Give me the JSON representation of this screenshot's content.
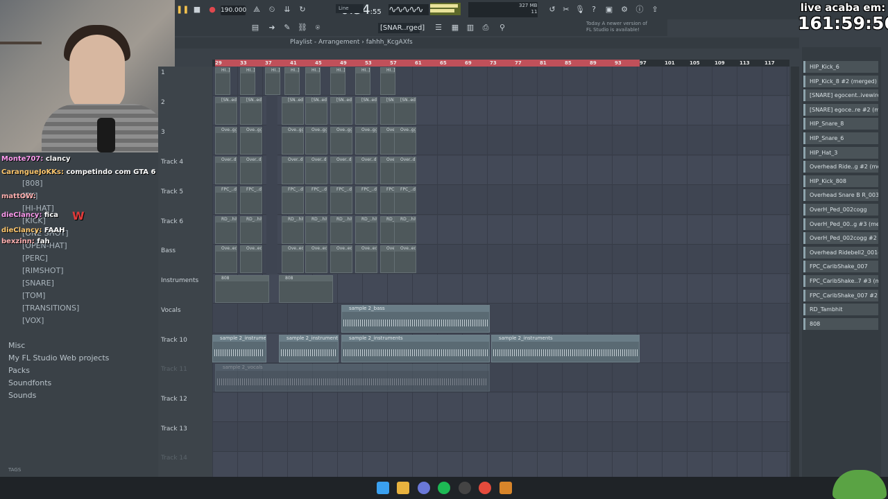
{
  "app": {
    "tempo": "190.000",
    "time": "0:34",
    "time_sub": ":55",
    "time_label": "M:S:CS",
    "pattern": "[SNAR..rged]",
    "snap": "Line",
    "memory": "327 MB",
    "cpu_line1": "2",
    "cpu_line2": "11",
    "news_line1": "Today  A newer version of",
    "news_line2": "FL Studio is available!"
  },
  "overlay": {
    "live_label": "live acaba em:",
    "countdown": "161:59:56"
  },
  "playlist": {
    "title": "Playlist - Arrangement",
    "pattern_name": "fahhh_KcgAXfs"
  },
  "ruler": [
    "29",
    "33",
    "37",
    "41",
    "45",
    "49",
    "53",
    "57",
    "61",
    "65",
    "69",
    "73",
    "77",
    "81",
    "85",
    "89",
    "93",
    "97",
    "101",
    "105",
    "109",
    "113",
    "117"
  ],
  "tracks": [
    {
      "name": "1",
      "dim": false
    },
    {
      "name": "2",
      "dim": false
    },
    {
      "name": "3",
      "dim": false
    },
    {
      "name": "Track 4",
      "dim": false
    },
    {
      "name": "Track 5",
      "dim": false
    },
    {
      "name": "Track 6",
      "dim": false
    },
    {
      "name": "Bass",
      "dim": false
    },
    {
      "name": "Instruments",
      "dim": false
    },
    {
      "name": "Vocals",
      "dim": false
    },
    {
      "name": "Track 10",
      "dim": false
    },
    {
      "name": "Track 11",
      "dim": true
    },
    {
      "name": "Track 12",
      "dim": false
    },
    {
      "name": "Track 13",
      "dim": false
    },
    {
      "name": "Track 14",
      "dim": true
    }
  ],
  "clips": {
    "t1": "HI..]",
    "t2": "[SN..ed]",
    "t2b": "[S..ed]",
    "t3": "Ove..gg",
    "t4": "Over..d]",
    "t5": "FPC_..d]",
    "t6": "RD_..hit",
    "t7": "Ove..ed]",
    "t8": "808",
    "vocals": "sample 2_bass",
    "instruments": "sample 2_instruments",
    "muted_vocals": "sample 2_vocals"
  },
  "browser": {
    "items": [
      "[808]",
      "[FX]",
      "[HI-HAT]",
      "[KICK]",
      "[ONE SHOT]",
      "[OPEN-HAT]",
      "[PERC]",
      "[RIMSHOT]",
      "[SNARE]",
      "[TOM]",
      "[TRANSITIONS]",
      "[VOX]"
    ],
    "folders": [
      "Misc",
      "My FL Studio Web projects",
      "Packs",
      "Soundfonts",
      "Sounds"
    ],
    "tags_label": "TAGS"
  },
  "chat": [
    {
      "user": "Monte707:",
      "msg": "clancy"
    },
    {
      "user": "CarangueJoKKs:",
      "msg": "competindo com GTA 6"
    },
    {
      "user": "mattOW:",
      "msg": ""
    },
    {
      "user": "dieClancy:",
      "msg": "fica"
    },
    {
      "user": "dieClancy:",
      "msg": "FAAH"
    },
    {
      "user": "bexzinn:",
      "msg": "fah"
    }
  ],
  "chat_emote_text": "W",
  "rack": [
    "HIP_Kick_6",
    "HIP_Kick_8 #2 (merged)",
    "[SNARE] egocent..ivewire snare",
    "[SNARE] egoce..re #2 (merged)",
    "HIP_Snare_8",
    "HIP_Snare_6",
    "HIP_Hat_3",
    "Overhead Ride..g #2 (merged)",
    "HIP_Kick_808",
    "Overhead Snare B R_003ogg",
    "OverH_Ped_002cogg",
    "OverH_Ped_00..g #3 (merged)",
    "OverH_Ped_002cogg #2",
    "Overhead Ridebell2_001ogg",
    "FPC_CaribShake_007",
    "FPC_CaribShake..7 #3 (merged)",
    "FPC_CaribShake_007 #2",
    "RD_Tambhit",
    "808"
  ],
  "colors": {
    "loop": "#c0505a",
    "accent": "#8ea4ad"
  }
}
